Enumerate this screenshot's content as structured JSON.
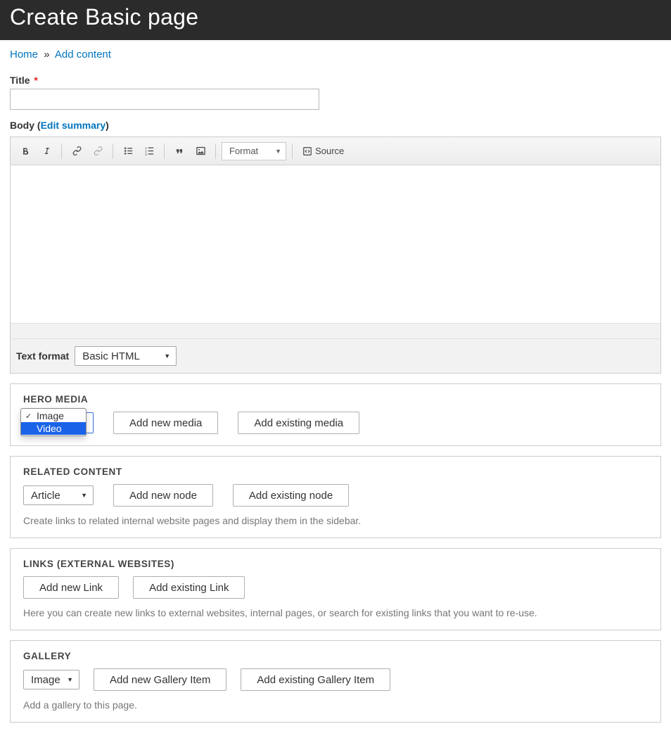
{
  "header": {
    "title": "Create Basic page"
  },
  "breadcrumb": {
    "home": "Home",
    "sep": "»",
    "add_content": "Add content"
  },
  "form": {
    "title_label": "Title",
    "required_marker": "*",
    "body_label": "Body",
    "edit_summary": "Edit summary",
    "text_format_label": "Text format",
    "text_format_value": "Basic HTML"
  },
  "ckeditor": {
    "format_label": "Format",
    "source_label": "Source"
  },
  "hero": {
    "title": "HERO MEDIA",
    "add_new": "Add new media",
    "add_existing": "Add existing media",
    "options": {
      "image": "Image",
      "video": "Video"
    }
  },
  "related": {
    "title": "RELATED CONTENT",
    "select_value": "Article",
    "add_new": "Add new node",
    "add_existing": "Add existing node",
    "help": "Create links to related internal website pages and display them in the sidebar."
  },
  "links": {
    "title": "LINKS (EXTERNAL WEBSITES)",
    "add_new": "Add new Link",
    "add_existing": "Add existing Link",
    "help": "Here you can create new links to external websites, internal pages, or search for existing links that you want to re-use."
  },
  "gallery": {
    "title": "GALLERY",
    "select_value": "Image",
    "add_new": "Add new Gallery Item",
    "add_existing": "Add existing Gallery Item",
    "help": "Add a gallery to this page."
  }
}
